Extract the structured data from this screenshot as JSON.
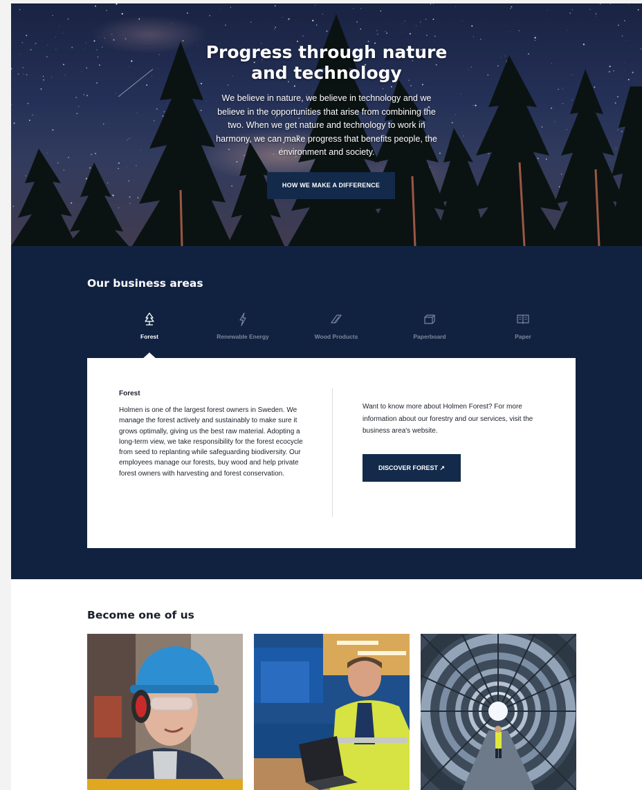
{
  "hero": {
    "title": "Progress through nature and technology",
    "text": "We believe in nature, we believe in technology and we believe in the opportunities that arise from combining the two. When we get nature and technology to work in harmony, we can make progress that benefits people, the environment and society.",
    "button_label": "HOW WE MAKE A DIFFERENCE"
  },
  "business": {
    "heading": "Our business areas",
    "tabs": [
      {
        "label": "Forest",
        "icon": "tree-icon",
        "active": true
      },
      {
        "label": "Renewable Energy",
        "icon": "lightning-icon",
        "active": false
      },
      {
        "label": "Wood Products",
        "icon": "wood-plank-icon",
        "active": false
      },
      {
        "label": "Paperboard",
        "icon": "box-icon",
        "active": false
      },
      {
        "label": "Paper",
        "icon": "book-icon",
        "active": false
      }
    ],
    "panel": {
      "title": "Forest",
      "text": "Holmen is one of the largest forest owners in Sweden. We manage the forest actively and sustainably to make sure it grows optimally, giving us the best raw material. Adopting a long-term view, we take responsibility for the forest ecocycle from seed to replanting while safeguarding biodiversity. Our employees manage our forests, buy wood and help private forest owners with harvesting and forest conservation.",
      "right_text": "Want to know more about Holmen Forest? For more information about our forestry and our services, visit the business area's website.",
      "button_label": "DISCOVER FOREST ↗"
    }
  },
  "careers": {
    "heading": "Become one of us",
    "cards": [
      {
        "image": "worker-with-helmet-photo"
      },
      {
        "image": "worker-at-laptop-photo"
      },
      {
        "image": "industrial-tunnel-photo"
      }
    ]
  },
  "colors": {
    "navy": "#112241",
    "button": "#132a4b",
    "white": "#ffffff"
  }
}
